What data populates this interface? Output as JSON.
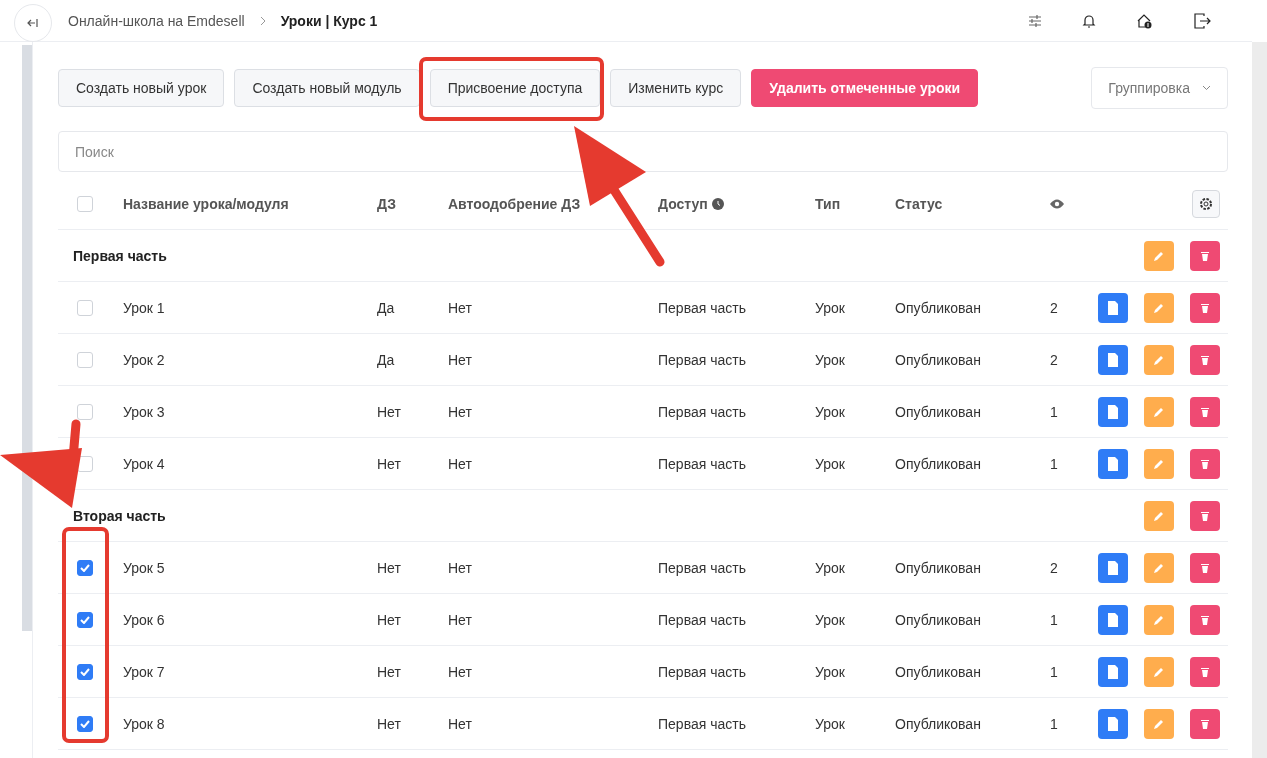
{
  "breadcrumb": {
    "root": "Онлайн-школа на Emdesell",
    "current": "Уроки | Курс 1"
  },
  "toolbar": [
    {
      "label": "Создать новый урок",
      "kind": "default"
    },
    {
      "label": "Создать новый модуль",
      "kind": "default"
    },
    {
      "label": "Присвоение доступа",
      "kind": "default"
    },
    {
      "label": "Изменить курс",
      "kind": "default"
    },
    {
      "label": "Удалить отмеченные уроки",
      "kind": "danger"
    }
  ],
  "grouping": {
    "label": "Группировка"
  },
  "search": {
    "placeholder": "Поиск"
  },
  "table": {
    "select_all": {
      "checked": false
    },
    "columns": [
      "Название урока/модуля",
      "ДЗ",
      "Автоодобрение ДЗ",
      "Доступ",
      "Тип",
      "Статус"
    ],
    "rows": [
      {
        "kind": "module",
        "name": "Первая часть"
      },
      {
        "kind": "lesson",
        "checked": false,
        "name": "Урок 1",
        "hw": "Да",
        "auto": "Нет",
        "access": "Первая часть",
        "type": "Урок",
        "status": "Опубликован",
        "views": "2"
      },
      {
        "kind": "lesson",
        "checked": false,
        "name": "Урок 2",
        "hw": "Да",
        "auto": "Нет",
        "access": "Первая часть",
        "type": "Урок",
        "status": "Опубликован",
        "views": "2"
      },
      {
        "kind": "lesson",
        "checked": false,
        "name": "Урок 3",
        "hw": "Нет",
        "auto": "Нет",
        "access": "Первая часть",
        "type": "Урок",
        "status": "Опубликован",
        "views": "1"
      },
      {
        "kind": "lesson",
        "checked": false,
        "name": "Урок 4",
        "hw": "Нет",
        "auto": "Нет",
        "access": "Первая часть",
        "type": "Урок",
        "status": "Опубликован",
        "views": "1"
      },
      {
        "kind": "module",
        "name": "Вторая часть"
      },
      {
        "kind": "lesson",
        "checked": true,
        "name": "Урок 5",
        "hw": "Нет",
        "auto": "Нет",
        "access": "Первая часть",
        "type": "Урок",
        "status": "Опубликован",
        "views": "2"
      },
      {
        "kind": "lesson",
        "checked": true,
        "name": "Урок 6",
        "hw": "Нет",
        "auto": "Нет",
        "access": "Первая часть",
        "type": "Урок",
        "status": "Опубликован",
        "views": "1"
      },
      {
        "kind": "lesson",
        "checked": true,
        "name": "Урок 7",
        "hw": "Нет",
        "auto": "Нет",
        "access": "Первая часть",
        "type": "Урок",
        "status": "Опубликован",
        "views": "1"
      },
      {
        "kind": "lesson",
        "checked": true,
        "name": "Урок 8",
        "hw": "Нет",
        "auto": "Нет",
        "access": "Первая часть",
        "type": "Урок",
        "status": "Опубликован",
        "views": "1"
      }
    ]
  }
}
